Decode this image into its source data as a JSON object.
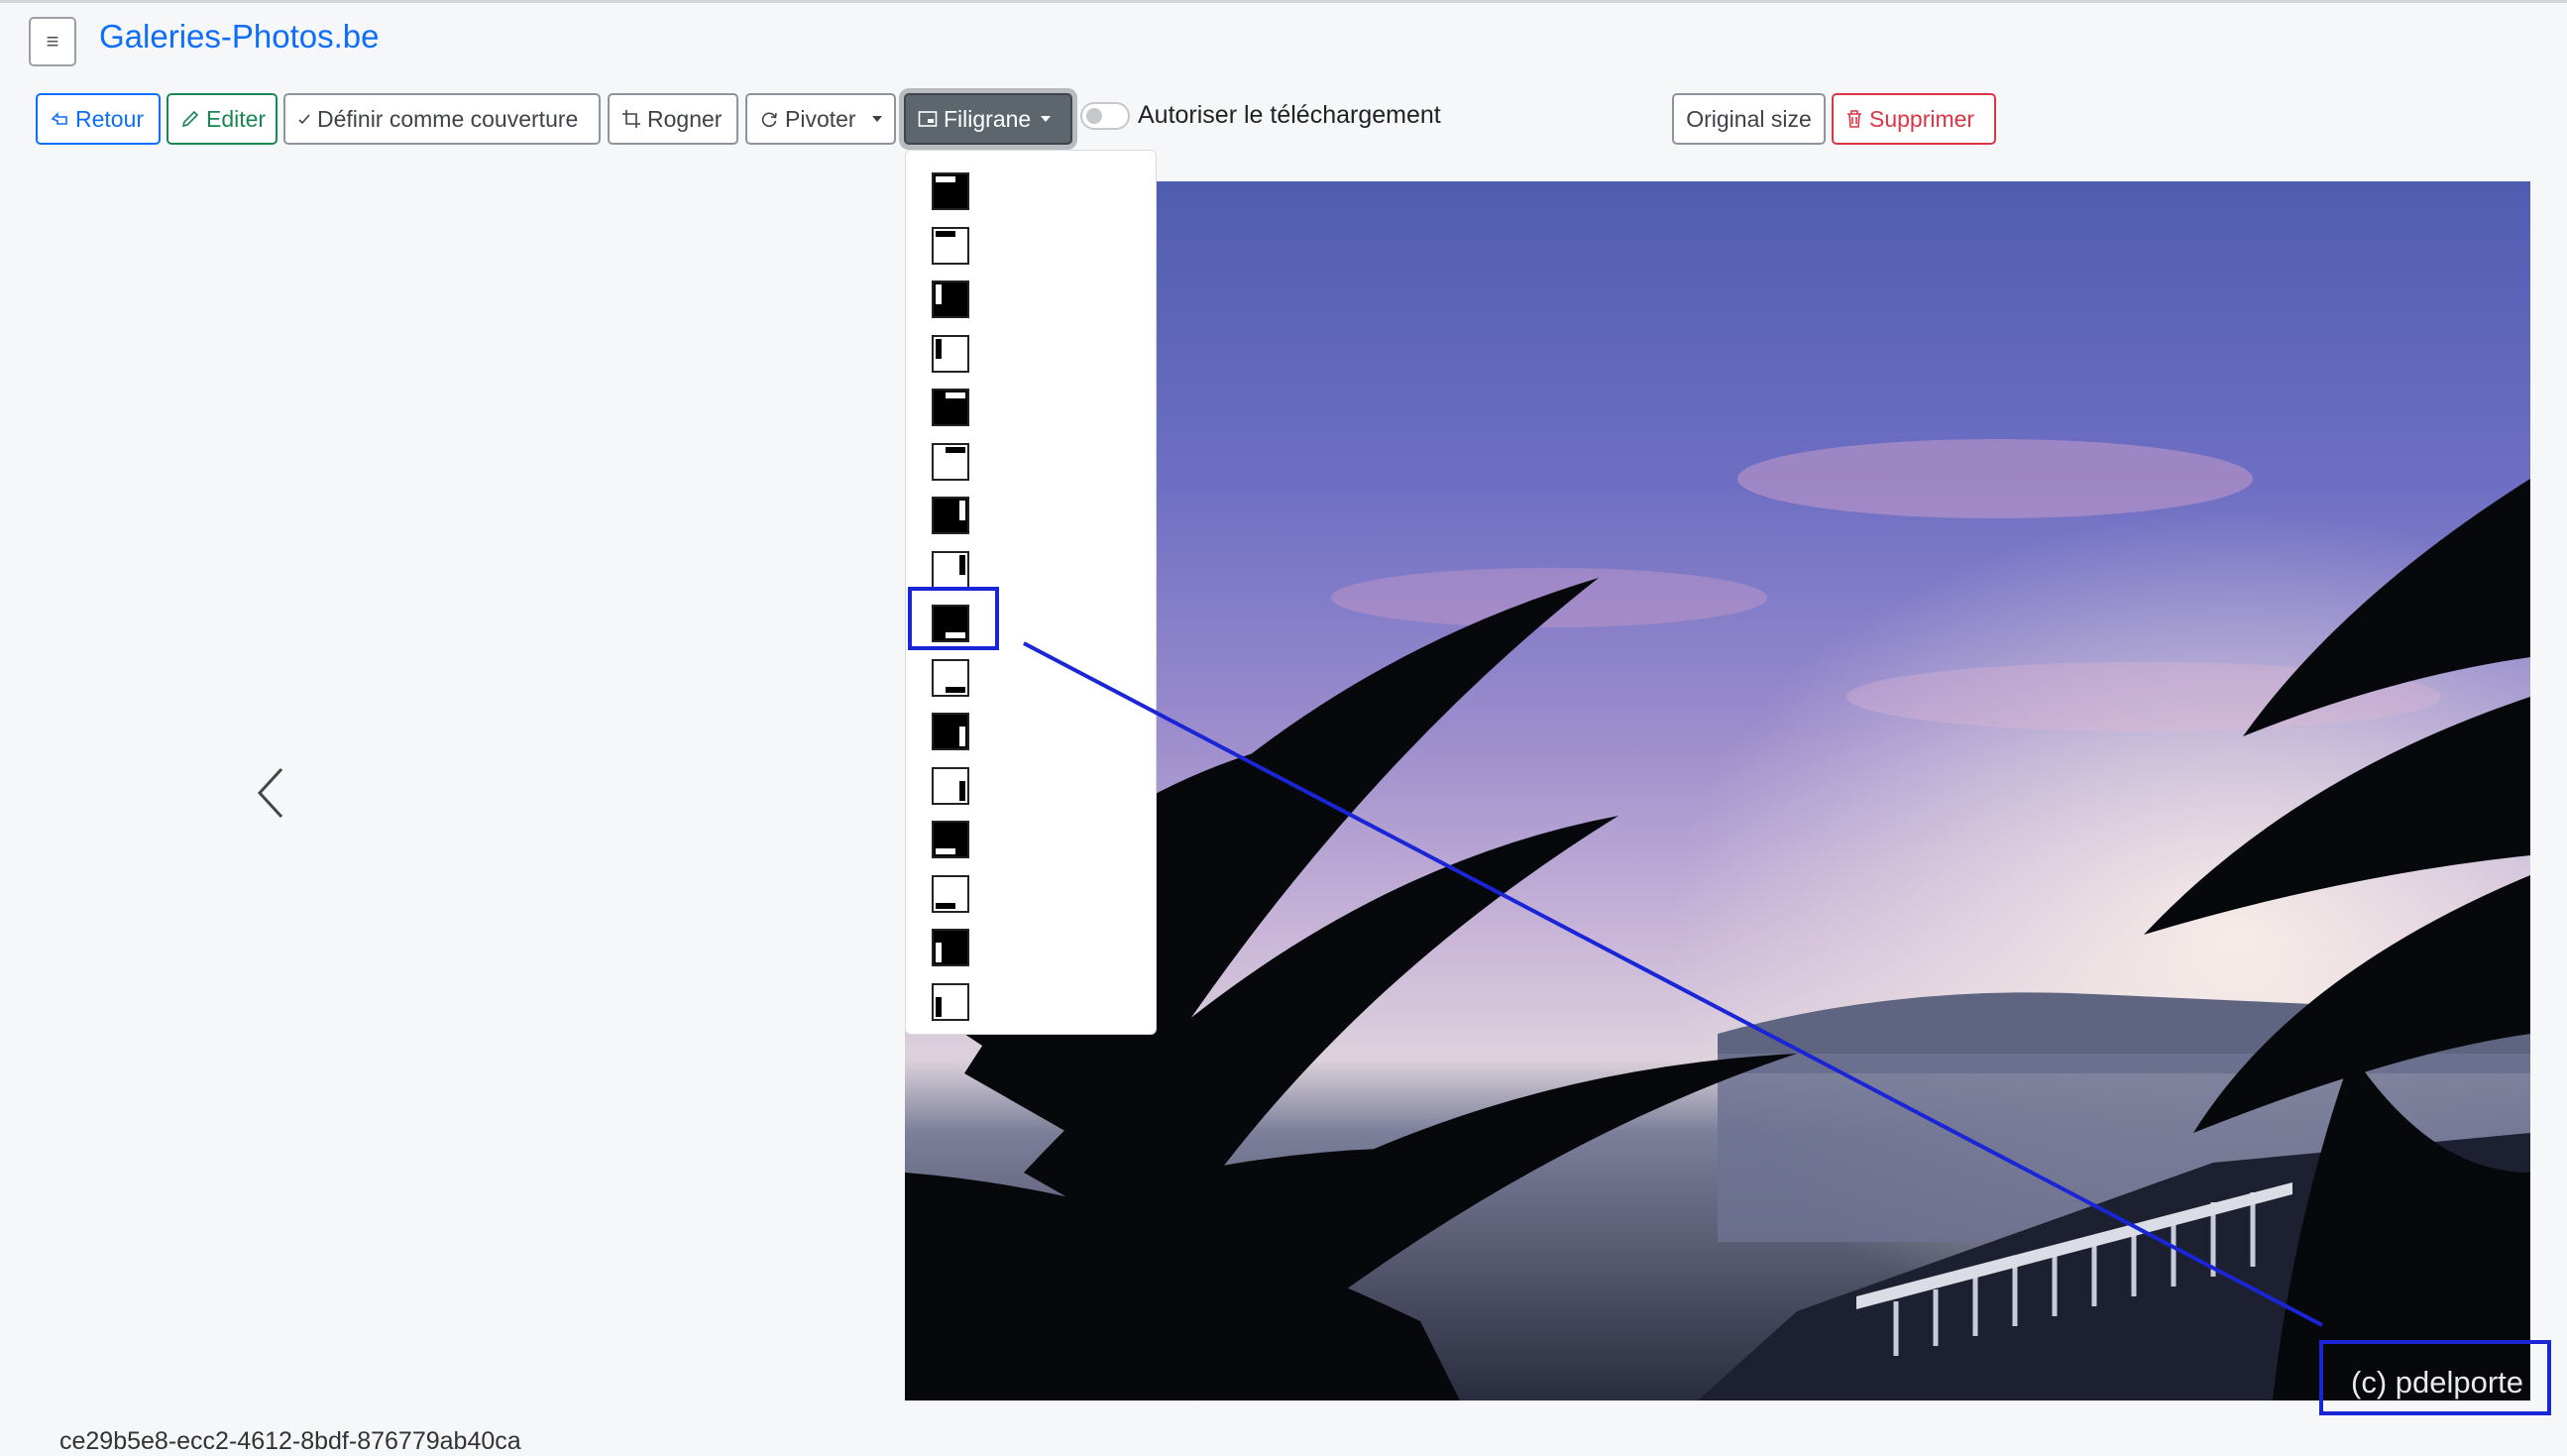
{
  "brand": "Galeries-Photos.be",
  "menu_icon": "≡",
  "toolbar": {
    "back": "Retour",
    "edit": "Editer",
    "set_cover": "Définir comme couverture",
    "crop": "Rogner",
    "rotate": "Pivoter",
    "watermark": "Filigrane",
    "allow_download": "Autoriser le téléchargement",
    "original_size": "Original size",
    "delete": "Supprimer"
  },
  "watermark_text": "(c) pdelporte",
  "bottom_id": "ce29b5e8-ecc2-4612-8bdf-876779ab40ca",
  "colors": {
    "brand": "#0d6efd",
    "success": "#198754",
    "danger": "#dc3545",
    "highlight": "#1a25d6"
  },
  "watermark_positions": [
    {
      "name": "top-left-horizontal",
      "filled": true
    },
    {
      "name": "top-left-horizontal",
      "filled": false
    },
    {
      "name": "top-left-vertical",
      "filled": true
    },
    {
      "name": "top-left-vertical",
      "filled": false
    },
    {
      "name": "top-right-horizontal",
      "filled": true
    },
    {
      "name": "top-right-horizontal",
      "filled": false
    },
    {
      "name": "top-right-vertical",
      "filled": true
    },
    {
      "name": "top-right-vertical",
      "filled": false
    },
    {
      "name": "bottom-right-horizontal",
      "filled": true,
      "selected": true
    },
    {
      "name": "bottom-right-horizontal",
      "filled": false
    },
    {
      "name": "bottom-right-vertical",
      "filled": true
    },
    {
      "name": "bottom-right-vertical",
      "filled": false
    },
    {
      "name": "bottom-left-horizontal",
      "filled": true
    },
    {
      "name": "bottom-left-horizontal",
      "filled": false
    },
    {
      "name": "bottom-left-vertical",
      "filled": true
    },
    {
      "name": "bottom-left-vertical",
      "filled": false
    }
  ]
}
